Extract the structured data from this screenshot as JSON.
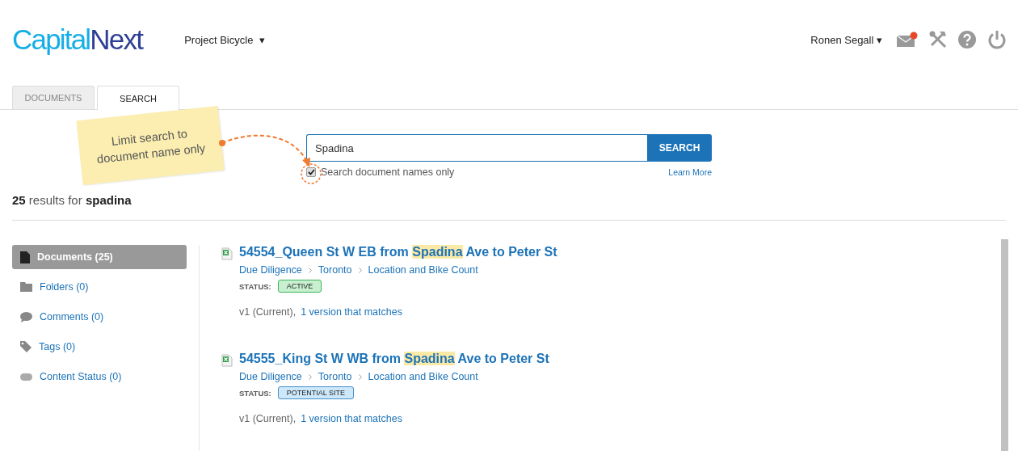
{
  "logo": {
    "part_1": "Capital",
    "part_2": "Next"
  },
  "project": {
    "label": "Project Bicycle",
    "caret": "▾"
  },
  "user": {
    "name": "Ronen Segall",
    "has_unread_mail": true
  },
  "tabs": [
    {
      "label": "DOCUMENTS",
      "selected": false
    },
    {
      "label": "SEARCH",
      "selected": true
    }
  ],
  "callout": {
    "text": "Limit search to document name only"
  },
  "search": {
    "value": "Spadina",
    "button": "SEARCH",
    "names_only": {
      "label": "Search document names only",
      "checked": true
    },
    "learn_more": "Learn More"
  },
  "summary": "**25** results for **spadina**",
  "facets": [
    {
      "kind": "document",
      "label": "Documents (25)",
      "selected": true
    },
    {
      "kind": "folder",
      "label": "Folders (0)",
      "selected": false
    },
    {
      "kind": "comment",
      "label": "Comments (0)",
      "selected": false
    },
    {
      "kind": "tag",
      "label": "Tags (0)",
      "selected": false
    },
    {
      "kind": "status",
      "label": "Content Status (0)",
      "selected": false
    }
  ],
  "results": [
    {
      "title": {
        "before": "54554_Queen St W EB from ",
        "match": "Spadina",
        "after": " Ave to Peter St"
      },
      "path": [
        "Due Diligence",
        "Toronto",
        "Location and Bike Count"
      ],
      "status_label": "STATUS:",
      "status": {
        "kind": "active",
        "label": "ACTIVE"
      },
      "version": "v1 (Current),",
      "matches": "1 version that matches"
    },
    {
      "title": {
        "before": "54555_King St W WB from ",
        "match": "Spadina",
        "after": " Ave to Peter St"
      },
      "path": [
        "Due Diligence",
        "Toronto",
        "Location and Bike Count"
      ],
      "status_label": "STATUS:",
      "status": {
        "kind": "potential",
        "label": "POTENTIAL SITE"
      },
      "version": "v1 (Current),",
      "matches": "1 version that matches"
    }
  ]
}
